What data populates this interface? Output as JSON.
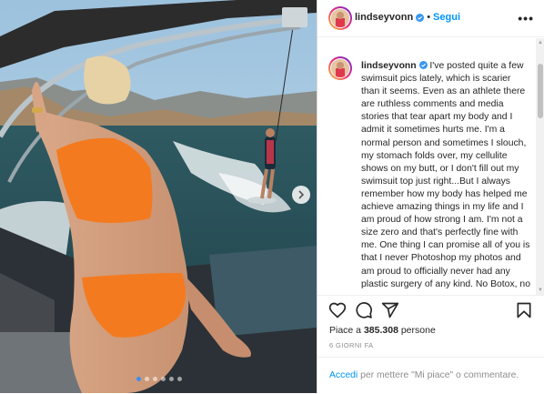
{
  "post": {
    "username": "lindseyvonn",
    "follow_separator": "•",
    "follow_label": "Segui",
    "more_icon": "•••",
    "caption": "I've posted quite a few swimsuit pics lately, which is scarier than it seems. Even as an athlete there are ruthless comments and media stories that tear apart my body and I admit it sometimes hurts me. I'm a normal person and sometimes I slouch, my stomach folds over, my cellulite shows on my butt, or I don't fill out my swimsuit top just right...But I always remember how my body has helped me achieve amazing things in my life and I am proud of how strong I am.  I'm not a size zero and that's perfectly fine with me. One thing I can promise all of you is that I never Photoshop my photos and am proud to officially never had any plastic surgery of any kind. No Botox, no",
    "likes_prefix": "Piace a ",
    "likes_count": "385.308",
    "likes_suffix": " persone",
    "date": "6 GIORNI FA",
    "login_link": "Accedi",
    "login_rest": " per mettere \"Mi piace\" o commentare."
  },
  "carousel": {
    "total_slides": 6,
    "active_slide": 1
  },
  "colors": {
    "accent": "#0095f6",
    "text": "#262626",
    "muted": "#8e8e8e",
    "swimsuit": "#f47a1f"
  }
}
